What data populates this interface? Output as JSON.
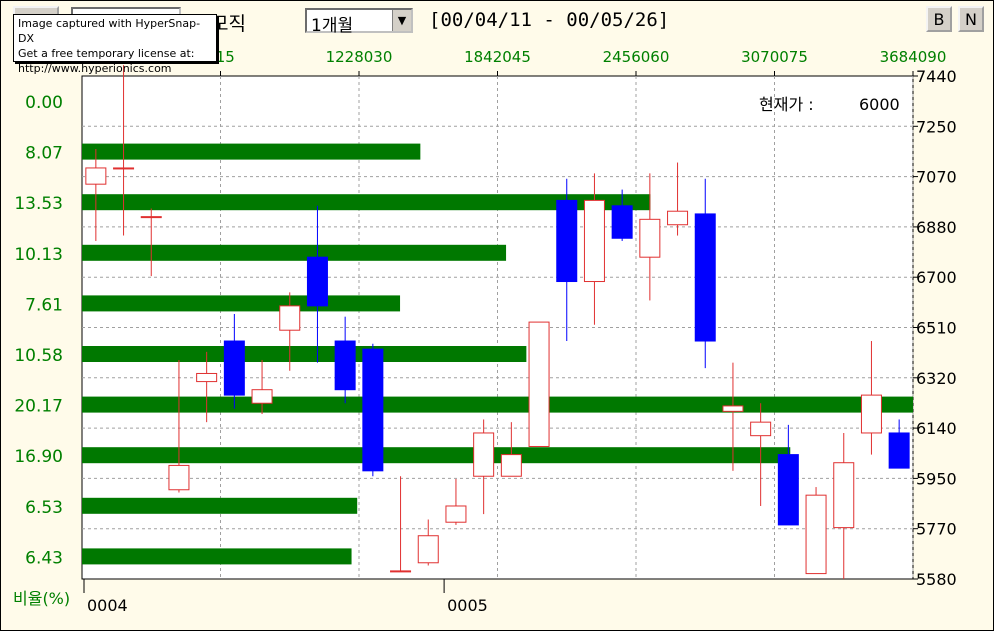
{
  "toolbar": {
    "left_button_label": "",
    "left_field_value": "",
    "title_text": "모직",
    "period_value": "1개월",
    "date_range": "[00/04/11 - 00/05/26]",
    "b_button_label": "B",
    "n_button_label": "N"
  },
  "watermark": {
    "line1": "Image captured with HyperSnap-DX",
    "line2": "Get a free temporary license at:",
    "line3": "http://www.hyperionics.com"
  },
  "colors": {
    "up": "#e03030",
    "down": "#0000ff",
    "volume_bar": "#007800",
    "grid": "#a0a0a0",
    "axis_text_green": "#008000",
    "background": "#fffbea"
  },
  "chart_data": {
    "type": "candlestick",
    "current_price_label": "현재가 :",
    "current_price_value": "6000",
    "ratio_axis_label": "비율(%)",
    "price_ticks": [
      "7440",
      "7250",
      "7070",
      "6880",
      "6700",
      "6510",
      "6320",
      "6140",
      "5950",
      "5770",
      "5580"
    ],
    "price_ylim": [
      5580,
      7440
    ],
    "volume_ticks": [
      "015",
      "1228030",
      "1842045",
      "2456060",
      "3070075",
      "3684090"
    ],
    "volume_values": [
      614015,
      1228030,
      1842045,
      2456060,
      3070075,
      3684090
    ],
    "volume_xlim": [
      0,
      3684090
    ],
    "date_ticks": [
      {
        "label": "0004",
        "index": -0.5
      },
      {
        "label": "0005",
        "index": 12.5
      }
    ],
    "volume_profile": [
      {
        "ratio": "0.00",
        "volume": 0
      },
      {
        "ratio": "8.07",
        "volume": 1500000
      },
      {
        "ratio": "13.53",
        "volume": 2520000
      },
      {
        "ratio": "10.13",
        "volume": 1880000
      },
      {
        "ratio": "7.61",
        "volume": 1410000
      },
      {
        "ratio": "10.58",
        "volume": 1970000
      },
      {
        "ratio": "20.17",
        "volume": 3780000
      },
      {
        "ratio": "16.90",
        "volume": 3140000
      },
      {
        "ratio": "6.53",
        "volume": 1220000
      },
      {
        "ratio": "6.43",
        "volume": 1195000
      }
    ],
    "candles": [
      {
        "open": 7040,
        "close": 7100,
        "high": 7170,
        "low": 6830
      },
      {
        "open": 7100,
        "close": 7100,
        "high": 7480,
        "low": 6850
      },
      {
        "open": 6920,
        "close": 6920,
        "high": 6950,
        "low": 6700
      },
      {
        "open": 5910,
        "close": 6000,
        "high": 6390,
        "low": 5900
      },
      {
        "open": 6310,
        "close": 6340,
        "high": 6420,
        "low": 6160
      },
      {
        "open": 6460,
        "close": 6260,
        "high": 6560,
        "low": 6210
      },
      {
        "open": 6230,
        "close": 6280,
        "high": 6390,
        "low": 6190
      },
      {
        "open": 6500,
        "close": 6590,
        "high": 6640,
        "low": 6350
      },
      {
        "open": 6770,
        "close": 6590,
        "high": 6960,
        "low": 6380
      },
      {
        "open": 6460,
        "close": 6280,
        "high": 6550,
        "low": 6230
      },
      {
        "open": 6430,
        "close": 5980,
        "high": 6450,
        "low": 5960
      },
      {
        "open": 5610,
        "close": 5610,
        "high": 5960,
        "low": 5610
      },
      {
        "open": 5640,
        "close": 5740,
        "high": 5800,
        "low": 5630
      },
      {
        "open": 5790,
        "close": 5850,
        "high": 5950,
        "low": 5780
      },
      {
        "open": 5960,
        "close": 6120,
        "high": 6170,
        "low": 5820
      },
      {
        "open": 5960,
        "close": 6040,
        "high": 6160,
        "low": 5960
      },
      {
        "open": 6070,
        "close": 6530,
        "high": 6530,
        "low": 6070
      },
      {
        "open": 6980,
        "close": 6680,
        "high": 7060,
        "low": 6460
      },
      {
        "open": 6680,
        "close": 6980,
        "high": 7080,
        "low": 6520
      },
      {
        "open": 6960,
        "close": 6840,
        "high": 7020,
        "low": 6830
      },
      {
        "open": 6770,
        "close": 6910,
        "high": 7080,
        "low": 6610
      },
      {
        "open": 6890,
        "close": 6940,
        "high": 7120,
        "low": 6850
      },
      {
        "open": 6930,
        "close": 6460,
        "high": 7060,
        "low": 6360
      },
      {
        "open": 6200,
        "close": 6220,
        "high": 6380,
        "low": 5980
      },
      {
        "open": 6110,
        "close": 6160,
        "high": 6230,
        "low": 5850
      },
      {
        "open": 6040,
        "close": 5780,
        "high": 6150,
        "low": 5780
      },
      {
        "open": 5600,
        "close": 5890,
        "high": 5920,
        "low": 5600
      },
      {
        "open": 5770,
        "close": 6010,
        "high": 6120,
        "low": 5580
      },
      {
        "open": 6120,
        "close": 6260,
        "high": 6460,
        "low": 6040
      },
      {
        "open": 6120,
        "close": 5990,
        "high": 6170,
        "low": 5990
      }
    ]
  }
}
